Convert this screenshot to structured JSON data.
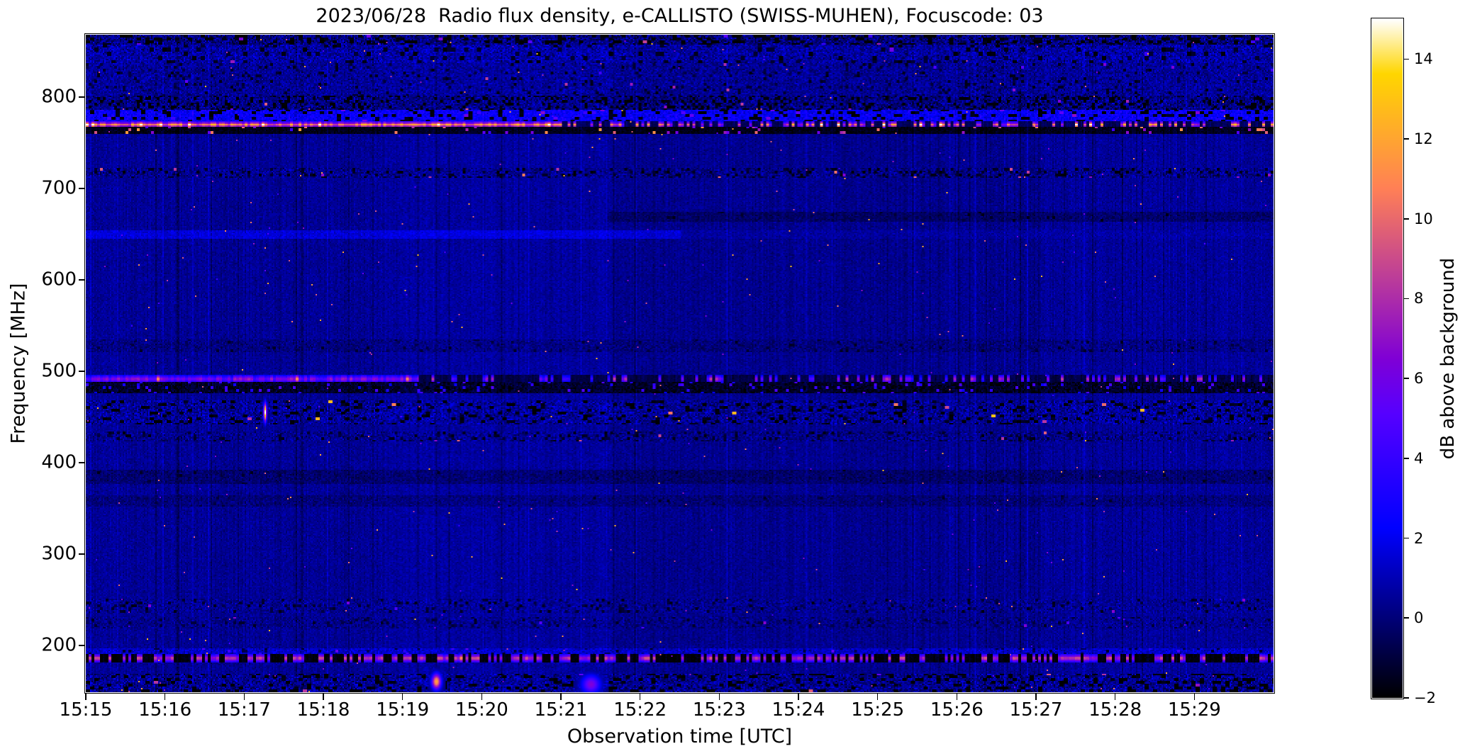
{
  "chart_data": {
    "type": "heatmap",
    "title": "2023/06/28  Radio flux density, e-CALLISTO (SWISS-MUHEN), Focuscode: 03",
    "xlabel": "Observation time [UTC]",
    "ylabel": "Frequency [MHz]",
    "x_ticks": [
      "15:15",
      "15:16",
      "15:17",
      "15:18",
      "15:19",
      "15:20",
      "15:21",
      "15:22",
      "15:23",
      "15:24",
      "15:25",
      "15:26",
      "15:27",
      "15:28",
      "15:29"
    ],
    "x_tick_minutes": [
      0,
      1,
      2,
      3,
      4,
      5,
      6,
      7,
      8,
      9,
      10,
      11,
      12,
      13,
      14
    ],
    "x_span_minutes": 15,
    "y_ticks": [
      800,
      700,
      600,
      500,
      400,
      300,
      200
    ],
    "y_range_mhz": [
      149,
      868
    ],
    "grid": false,
    "legend": "none",
    "colorbar": {
      "label": "dB above background",
      "ticks": [
        14,
        12,
        10,
        8,
        6,
        4,
        2,
        0,
        -2
      ],
      "vmin": -2,
      "vmax": 15,
      "colormap": "gnuplot2"
    },
    "background": {
      "base_db": 0.45,
      "pixel_noise_db": 0.55,
      "column_noise_db": 0.32,
      "bright_col_p": 0.05,
      "bright_col_db": 0.7,
      "segment_offsets": [
        [
          0.0,
          0.245,
          0.0
        ],
        [
          0.245,
          0.441,
          0.18
        ],
        [
          0.441,
          0.8,
          -0.12
        ],
        [
          0.8,
          1.0,
          0.1
        ]
      ],
      "sparkle_p": 0.0012,
      "sparkle_db": [
        4,
        13
      ]
    },
    "bands": [
      {
        "name": "top-edge-noise",
        "f": [
          856,
          868
        ],
        "base": 0.1,
        "noise": 1.6,
        "block": [
          3,
          2
        ],
        "dark_p": 0.25,
        "dark_db": -2,
        "bright_p": 0.012,
        "bright_db": [
          4,
          9
        ]
      },
      {
        "name": "upper-mottle",
        "f": [
          836,
          856
        ],
        "base": 0.7,
        "noise": 1.3,
        "block": [
          3,
          3
        ],
        "dark_p": 0.12,
        "dark_db": -1.5,
        "bright_p": 0.005,
        "bright_db": [
          4,
          8
        ]
      },
      {
        "name": "mottle",
        "f": [
          800,
          836
        ],
        "base": 0.5,
        "noise": 1.0,
        "block": [
          2,
          2
        ],
        "dark_p": 0.08,
        "dark_db": -1.2,
        "bright_p": 0.003,
        "bright_db": [
          4,
          9
        ]
      },
      {
        "name": "speckle-790",
        "f": [
          785,
          800
        ],
        "base": 0.2,
        "noise": 1.4,
        "block": [
          2,
          2
        ],
        "dark_p": 0.22,
        "dark_db": -2,
        "bright_p": 0.005,
        "bright_db": [
          5,
          10
        ]
      },
      {
        "name": "blue-band-779",
        "f": [
          773,
          785
        ],
        "base": 2.3,
        "noise": 1.1,
        "block": [
          3,
          2
        ],
        "dark_p": 0.18,
        "dark_db": -1.8,
        "bright_p": 0.01,
        "bright_db": [
          4,
          7
        ]
      },
      {
        "name": "rfi-line-769",
        "f": [
          766,
          773
        ],
        "line": true,
        "cont_until": 0.4,
        "cont_db": [
          8,
          13
        ],
        "dash_p": 0.4,
        "dash_db": [
          5,
          13
        ],
        "off_db": -0.5,
        "peak_p": 0.06,
        "peak_db": 15,
        "hot": [
          0.6,
          0.72
        ]
      },
      {
        "name": "black-gap-763",
        "f": [
          760,
          766
        ],
        "base": -1.6,
        "noise": 0.5,
        "block": [
          2,
          2
        ],
        "dark_p": 0.0,
        "dark_db": -2,
        "bright_p": 0.05,
        "bright_db": [
          4,
          12
        ]
      },
      {
        "name": "speckle-718",
        "f": [
          713,
          722
        ],
        "base": 0.3,
        "noise": 1.2,
        "block": [
          2,
          2
        ],
        "dark_p": 0.15,
        "dark_db": -1.5,
        "bright_p": 0.007,
        "bright_db": [
          6,
          11
        ]
      },
      {
        "name": "dark-streak-669",
        "f": [
          664,
          674
        ],
        "base": -0.25,
        "noise": 0.6,
        "block": [
          2,
          2
        ],
        "dark_p": 0.04,
        "dark_db": -1.2,
        "bright_p": 0.0,
        "bright_db": [
          2,
          4
        ],
        "x": [
          0.44,
          1.0
        ]
      },
      {
        "name": "faint-line-649",
        "f": [
          645,
          653
        ],
        "base": 1.6,
        "noise": 0.6,
        "block": [
          2,
          2
        ],
        "dark_p": 0.0,
        "dark_db": -1,
        "bright_p": 0.0,
        "bright_db": [
          3,
          5
        ],
        "fade_after": 0.5,
        "fade_db": 0.7
      },
      {
        "name": "dim-528",
        "f": [
          522,
          534
        ],
        "base": 0.1,
        "noise": 0.8,
        "block": [
          2,
          2
        ],
        "dark_p": 0.05,
        "dark_db": -1.0,
        "bright_p": 0.0,
        "bright_db": [
          2,
          4
        ]
      },
      {
        "name": "rfi-line-491",
        "f": [
          488,
          495
        ],
        "line": true,
        "cont_until": 0.28,
        "cont_db": [
          4.5,
          8.5
        ],
        "dash_p": 0.3,
        "dash_db": [
          3.5,
          9.5
        ],
        "off_db": -0.8,
        "peak_p": 0.02,
        "peak_db": 12
      },
      {
        "name": "black-band-483",
        "f": [
          477,
          488
        ],
        "base": -1.3,
        "noise": 0.8,
        "block": [
          2,
          2
        ],
        "dark_p": 0.1,
        "dark_db": -2,
        "bright_p": 0.06,
        "bright_db": [
          2,
          5
        ]
      },
      {
        "name": "noisy-455",
        "f": [
          443,
          468
        ],
        "base": 0.5,
        "noise": 1.4,
        "block": [
          3,
          2
        ],
        "dark_p": 0.15,
        "dark_db": -1.8,
        "bright_p": 0.006,
        "bright_db": [
          6,
          13
        ]
      },
      {
        "name": "speckle-428",
        "f": [
          424,
          433
        ],
        "base": 0.3,
        "noise": 1.1,
        "block": [
          2,
          2
        ],
        "dark_p": 0.12,
        "dark_db": -1.3,
        "bright_p": 0.004,
        "bright_db": [
          6,
          10
        ]
      },
      {
        "name": "dark-385",
        "f": [
          377,
          392
        ],
        "base": -0.2,
        "noise": 0.7,
        "block": [
          2,
          2
        ],
        "dark_p": 0.02,
        "dark_db": -1.2,
        "bright_p": 0.0,
        "bright_db": [
          2,
          4
        ]
      },
      {
        "name": "dark-358",
        "f": [
          352,
          363
        ],
        "base": 0.0,
        "noise": 0.7,
        "block": [
          2,
          2
        ],
        "dark_p": 0.02,
        "dark_db": -1.0,
        "bright_p": 0.0,
        "bright_db": [
          2,
          4
        ]
      },
      {
        "name": "speckle-243",
        "f": [
          236,
          250
        ],
        "base": 0.4,
        "noise": 1.0,
        "block": [
          2,
          2
        ],
        "dark_p": 0.1,
        "dark_db": -1.2,
        "bright_p": 0.003,
        "bright_db": [
          4,
          8
        ]
      },
      {
        "name": "speckle-225",
        "f": [
          220,
          230
        ],
        "base": 0.3,
        "noise": 0.9,
        "block": [
          2,
          2
        ],
        "dark_p": 0.08,
        "dark_db": -1.0,
        "bright_p": 0.002,
        "bright_db": [
          4,
          7
        ]
      },
      {
        "name": "blue-row-193",
        "f": [
          190,
          197
        ],
        "base": 1.3,
        "noise": 1.0,
        "block": [
          2,
          2
        ],
        "dark_p": 0.05,
        "dark_db": -1,
        "bright_p": 0.012,
        "bright_db": [
          3,
          6
        ]
      },
      {
        "name": "rfi-dash-186",
        "f": [
          182,
          190
        ],
        "line": true,
        "cont_until": 0.0,
        "cont_db": [
          7,
          10
        ],
        "dash_p": 0.45,
        "dash_db": [
          7,
          10.5
        ],
        "off_db": -1.8,
        "peak_p": 0.012,
        "peak_db": 12
      },
      {
        "name": "bottom-noise-160",
        "f": [
          150,
          168
        ],
        "base": 0.4,
        "noise": 1.5,
        "block": [
          3,
          2
        ],
        "dark_p": 0.2,
        "dark_db": -2,
        "bright_p": 0.005,
        "bright_db": [
          5,
          10
        ]
      }
    ],
    "blobs": [
      {
        "x": 0.295,
        "f_mhz": 161,
        "db": 12,
        "rx": 3,
        "ry": 5
      },
      {
        "x": 0.425,
        "f_mhz": 158,
        "db": 6.5,
        "rx": 6,
        "ry": 6
      },
      {
        "x": 0.15,
        "f_mhz": 456,
        "db": 15,
        "rx": 1,
        "ry": 6
      }
    ]
  }
}
